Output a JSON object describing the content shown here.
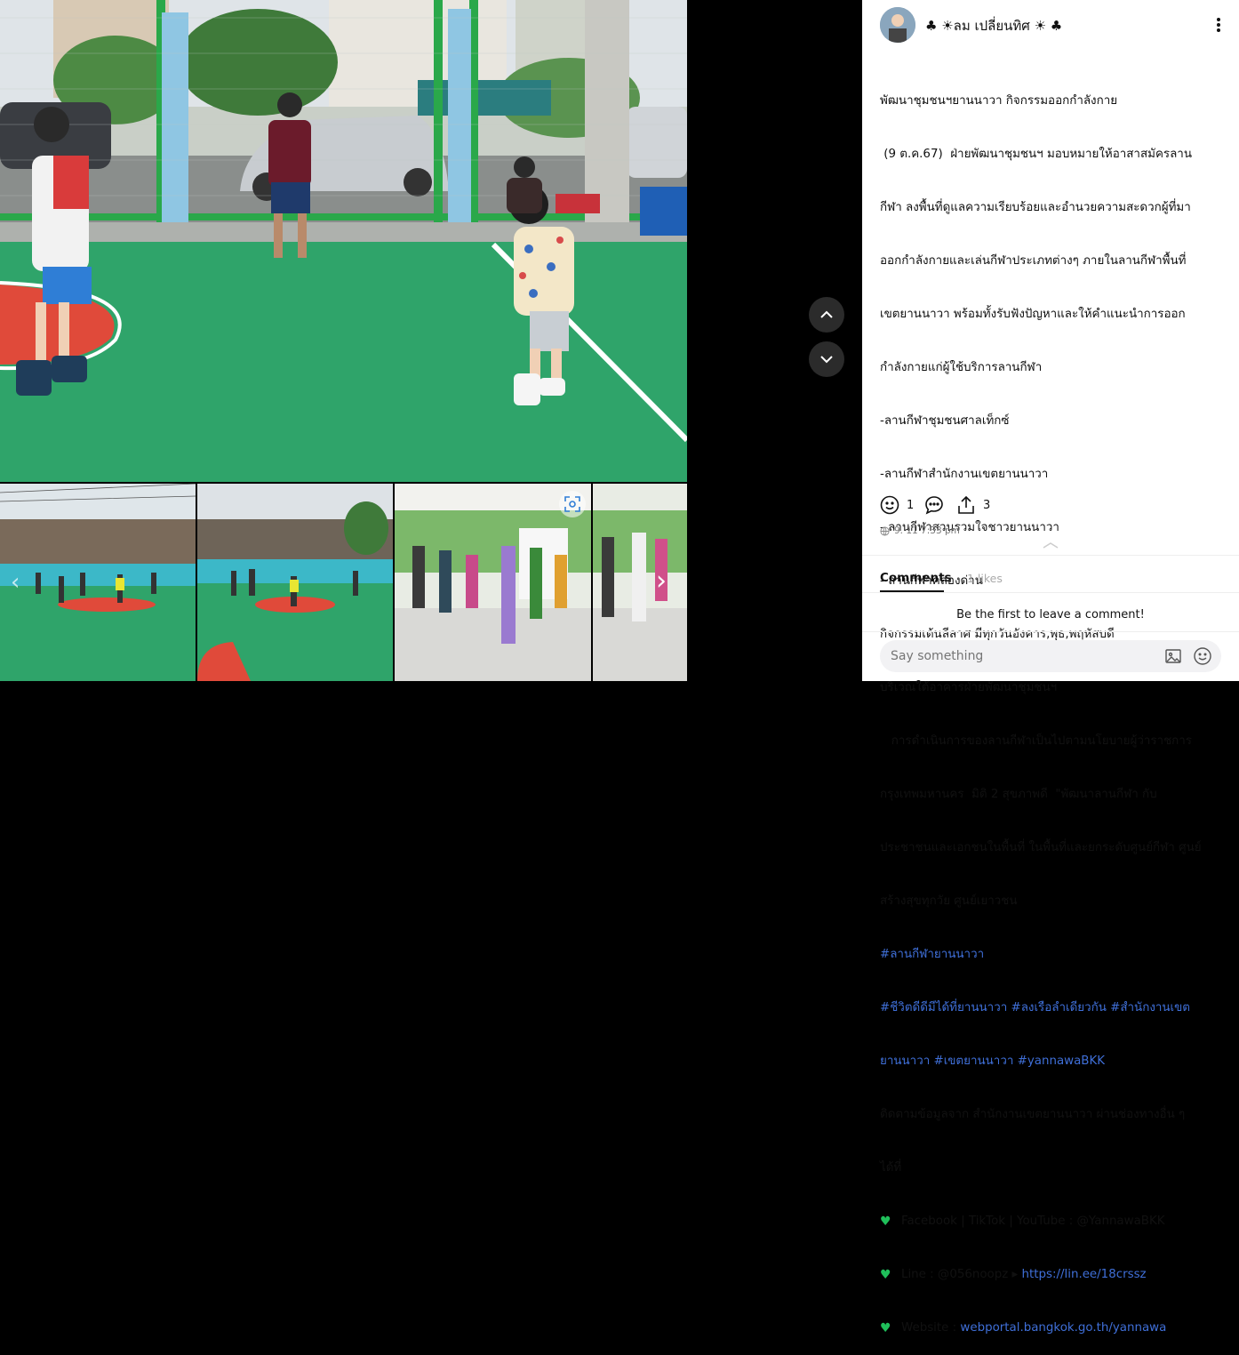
{
  "post": {
    "author_name": "♣ ☀ลม เปลี่ยนทิศ ☀ ♣",
    "text_lines": [
      "พัฒนาชุมชนฯยานนาวา กิจกรรมออกกำลังกาย",
      " (9 ต.ค.67)  ฝ่ายพัฒนาชุมชนฯ มอบหมายให้อาสาสมัครลาน",
      "กีฬา ลงพื้นที่ดูแลความเรียบร้อยและอำนวยความสะดวกผู้ที่มา",
      "ออกกำลังกายและเล่นกีฬาประเภทต่างๆ ภายในลานกีฬาพื้นที่",
      "เขตยานนาวา พร้อมทั้งรับฟังปัญหาและให้คำแนะนำการออก",
      "กำลังกายแก่ผู้ใช้บริการลานกีฬา",
      "-ลานกีฬาชุมชนศาลเท็กซ์",
      "-ลานกีฬาสำนักงานเขตยานนาวา",
      "- ลานกีฬาสวนรวมใจชาวยานนาวา",
      "- ลานกีฬาคลองด่าน",
      "กิจกรรมเต้นลีลาศ มีทุกวันอังคาร,พุธ,พฤหัสบดี",
      "บริเวณใต้อาคารฝ่ายพัฒนาชุมชนฯ",
      "   การดำเนินการของลานกีฬาเป็นไปตามนโยบายผู้ว่าราชการ",
      "กรุงเทพมหานคร  มิติ 2 สุขภาพดี  \"พัฒนาลานกีฬา กับ",
      "ประชาชนและเอกชนในพื้นที่ ในพื้นที่และยกระดับศูนย์กีฬา ศูนย์",
      "สร้างสุขทุกวัย ศูนย์เยาวชน"
    ],
    "hashtags_1": "#ลานกีฬายานนาวา",
    "hashtags_2": "#ชีวิตดีดีมีได้ที่ยานนาวา #ลงเรือลำเดียวกัน #สำนักงานเขต",
    "hashtags_3": "ยานนาวา #เขตยานนาวา #yannawaBKK",
    "follow_line_1": "ติดตามข้อมูลจาก สำนักงานเขตยานนาวา ผ่านช่องทางอื่น ๆ",
    "follow_line_2": "ได้ที่",
    "contact_social": "Facebook | TikTok | YouTube : @YannawaBKK",
    "contact_line_prefix": "Line : @056noopz ▸ ",
    "contact_line_link": "https://lin.ee/18crssz",
    "contact_website_prefix": "Website : ",
    "contact_website_link": "webportal.bangkok.go.th/yannawa",
    "reactions_count": "1",
    "shares_count": "3",
    "timestamp": "9. 11 7:33 pm"
  },
  "comments": {
    "tab_label": "Comments",
    "likes_label": "1 likes",
    "empty_text": "Be the first to leave a comment!",
    "input_placeholder": "Say something"
  },
  "colors": {
    "link": "#3f6fd8",
    "heart": "#1fbf5a",
    "court_green": "#2fa46a",
    "court_red": "#e04a3a"
  },
  "icons": [
    "globe-icon",
    "smile-icon",
    "comment-icon",
    "share-icon",
    "more-icon",
    "chevron-up-icon",
    "chevron-down-icon",
    "image-icon",
    "emoji-icon",
    "scan-icon",
    "prev-icon",
    "next-icon"
  ]
}
